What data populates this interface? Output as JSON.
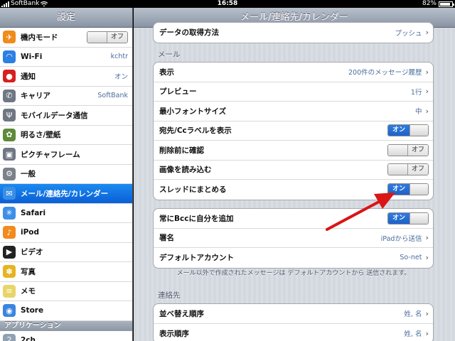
{
  "status": {
    "carrier": "SoftBank",
    "time": "16:58",
    "battery": "82%",
    "battery_level": 0.82
  },
  "sidebar": {
    "title": "設定",
    "items": [
      {
        "label": "機内モード",
        "icon": "airplane-icon",
        "color": "#f08b1c",
        "glyph": "✈",
        "toggle": {
          "state": "off",
          "text": "オフ"
        }
      },
      {
        "label": "Wi-Fi",
        "icon": "wifi-icon",
        "color": "#2c7fe3",
        "glyph": "◠",
        "value": "kchtr"
      },
      {
        "label": "通知",
        "icon": "notification-icon",
        "color": "#d81f1f",
        "glyph": "●",
        "value": "オン"
      },
      {
        "label": "キャリア",
        "icon": "phone-icon",
        "color": "#6f7784",
        "glyph": "✆",
        "value": "SoftBank"
      },
      {
        "label": "モバイルデータ通信",
        "icon": "antenna-icon",
        "color": "#6f7784",
        "glyph": "Ψ"
      },
      {
        "label": "明るさ/壁紙",
        "icon": "brightness-icon",
        "color": "#5e8a3a",
        "glyph": "✿"
      },
      {
        "label": "ピクチャフレーム",
        "icon": "picture-frame-icon",
        "color": "#6f7784",
        "glyph": "▣"
      },
      {
        "label": "一般",
        "icon": "gear-icon",
        "color": "#7b818a",
        "glyph": "⚙"
      },
      {
        "label": "メール/連絡先/カレンダー",
        "icon": "mail-icon",
        "color": "#3a8ee6",
        "glyph": "✉",
        "selected": true
      },
      {
        "label": "Safari",
        "icon": "safari-icon",
        "color": "#3d8fe8",
        "glyph": "✳"
      },
      {
        "label": "iPod",
        "icon": "ipod-icon",
        "color": "#f28a1d",
        "glyph": "♪"
      },
      {
        "label": "ビデオ",
        "icon": "video-icon",
        "color": "#222222",
        "glyph": "▶"
      },
      {
        "label": "写真",
        "icon": "photos-icon",
        "color": "#e6b422",
        "glyph": "✽"
      },
      {
        "label": "メモ",
        "icon": "notes-icon",
        "color": "#e8d56a",
        "glyph": "≡"
      },
      {
        "label": "Store",
        "icon": "store-icon",
        "color": "#3b84e0",
        "glyph": "◉"
      }
    ],
    "section": "アプリケーション",
    "after_section": [
      {
        "label": "2ch",
        "icon": "app-2ch-icon",
        "color": "#8fa1b3",
        "glyph": "2"
      }
    ]
  },
  "main": {
    "title": "メール/連絡先/カレンダー",
    "top_group": [
      {
        "label": "データの取得方法",
        "value": "プッシュ"
      }
    ],
    "mail_header": "メール",
    "mail_group": [
      {
        "label": "表示",
        "value": "200件のメッセージ履歴"
      },
      {
        "label": "プレビュー",
        "value": "1行"
      },
      {
        "label": "最小フォントサイズ",
        "value": "中"
      },
      {
        "label": "宛先/Ccラベルを表示",
        "toggle": {
          "state": "on",
          "text": "オン"
        }
      },
      {
        "label": "削除前に確認",
        "toggle": {
          "state": "off",
          "text": "オフ"
        }
      },
      {
        "label": "画像を読み込む",
        "toggle": {
          "state": "off",
          "text": "オフ"
        }
      },
      {
        "label": "スレッドにまとめる",
        "toggle": {
          "state": "on",
          "text": "オン"
        }
      }
    ],
    "account_group": [
      {
        "label": "常にBccに自分を追加",
        "toggle": {
          "state": "on",
          "text": "オン"
        }
      },
      {
        "label": "署名",
        "value": "iPadから送信"
      },
      {
        "label": "デフォルトアカウント",
        "value": "So-net"
      }
    ],
    "footnote": "メール以外で作成されたメッセージは デフォルトアカウントから 送信されます。",
    "contacts_header": "連絡先",
    "contacts_group": [
      {
        "label": "並べ替え順序",
        "value": "姓, 名"
      },
      {
        "label": "表示順序",
        "value": "姓, 名"
      }
    ]
  },
  "colors": {
    "accent": "#1d62c8",
    "value_text": "#4a6c9b",
    "arrow": "#d91515"
  }
}
